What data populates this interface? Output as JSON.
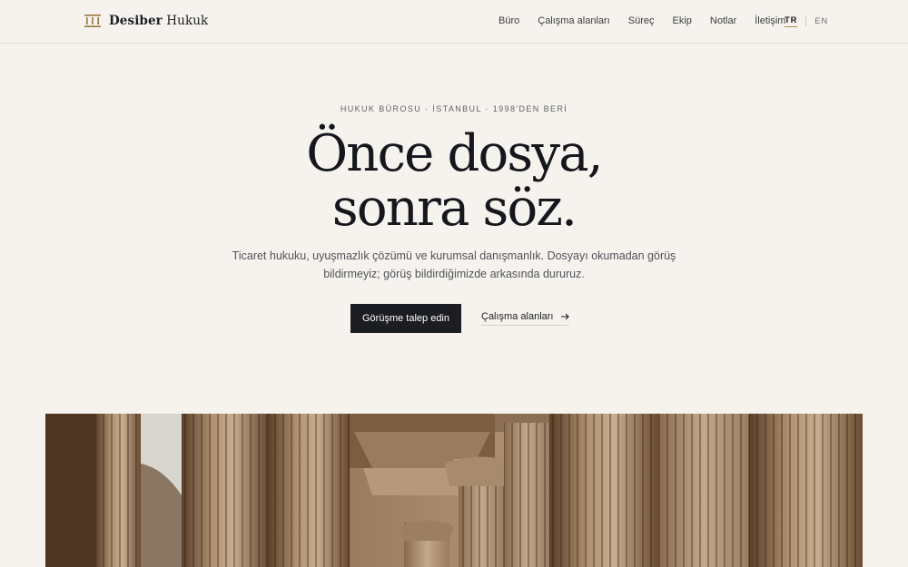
{
  "brand": {
    "name_bold": "Desiber",
    "name_light": "Hukuk",
    "icon": "columns-logo-icon"
  },
  "nav": {
    "items": [
      {
        "label": "Büro"
      },
      {
        "label": "Çalışma alanları"
      },
      {
        "label": "Süreç"
      },
      {
        "label": "Ekip"
      },
      {
        "label": "Notlar"
      },
      {
        "label": "İletişim"
      }
    ]
  },
  "language": {
    "active": "TR",
    "other": "EN"
  },
  "hero": {
    "eyebrow": "HUKUK BÜROSU · İSTANBUL · 1998'DEN BERİ",
    "headline_line1": "Önce dosya,",
    "headline_line2": "sonra söz.",
    "lede": "Ticaret hukuku, uyuşmazlık çözümü ve kurumsal danışmanlık. Dosyayı okumadan görüş bildirmeyiz; görüş bildirdiğimizde arkasında dururuz.",
    "primary_cta": "Görüşme talep edin",
    "secondary_cta": "Çalışma alanları"
  },
  "image": {
    "subject": "classical-columns-photo"
  },
  "colors": {
    "background": "#f6f3ee",
    "ink": "#1b1d22",
    "accent": "#b08a4e",
    "button": "#1b1d22"
  }
}
